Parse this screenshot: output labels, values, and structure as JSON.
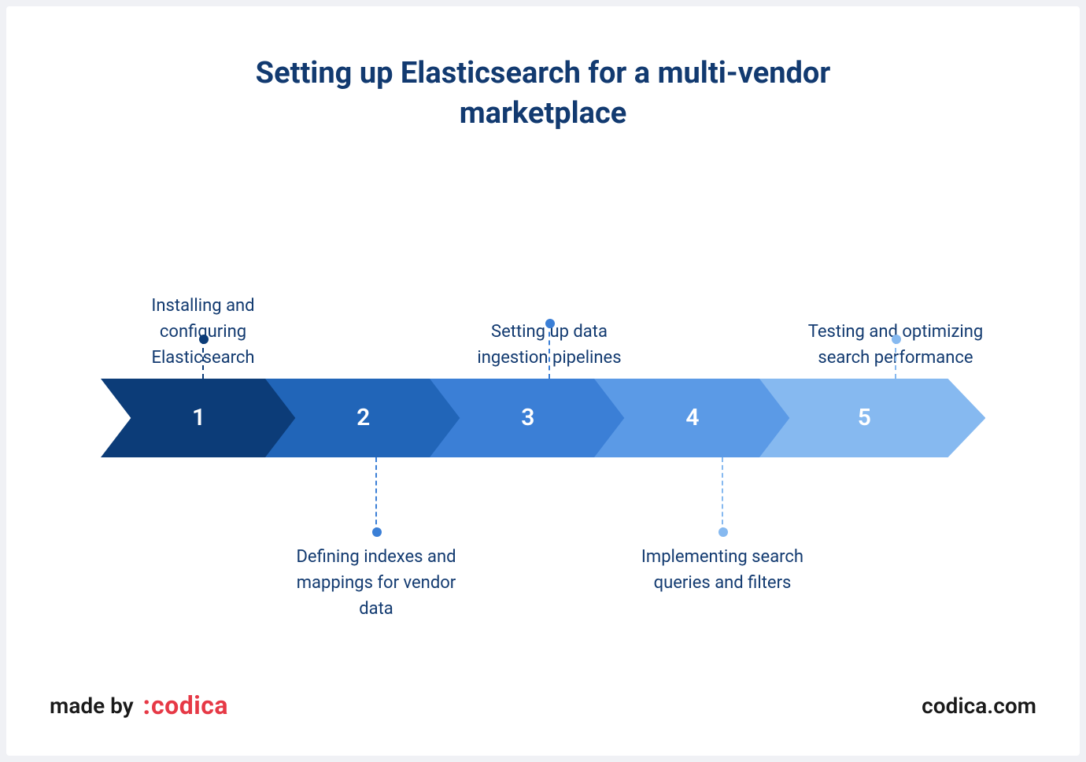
{
  "title": "Setting up Elasticsearch for a multi-vendor marketplace",
  "steps": [
    {
      "num": "1",
      "label": "Installing and configuring Elasticsearch",
      "color": "#0c3c78",
      "position": "top"
    },
    {
      "num": "2",
      "label": "Defining indexes and mappings for vendor data",
      "color": "#2165b8",
      "position": "bottom"
    },
    {
      "num": "3",
      "label": "Setting up data ingestion pipelines",
      "color": "#3b7fd6",
      "position": "top"
    },
    {
      "num": "4",
      "label": "Implementing search queries and filters",
      "color": "#5b9ae6",
      "position": "bottom"
    },
    {
      "num": "5",
      "label": "Testing and optimizing search performance",
      "color": "#86b9f0",
      "position": "top"
    }
  ],
  "footer": {
    "made_by": "made by",
    "logo_colon": ":",
    "logo_name": "codica",
    "site": "codica.com"
  }
}
